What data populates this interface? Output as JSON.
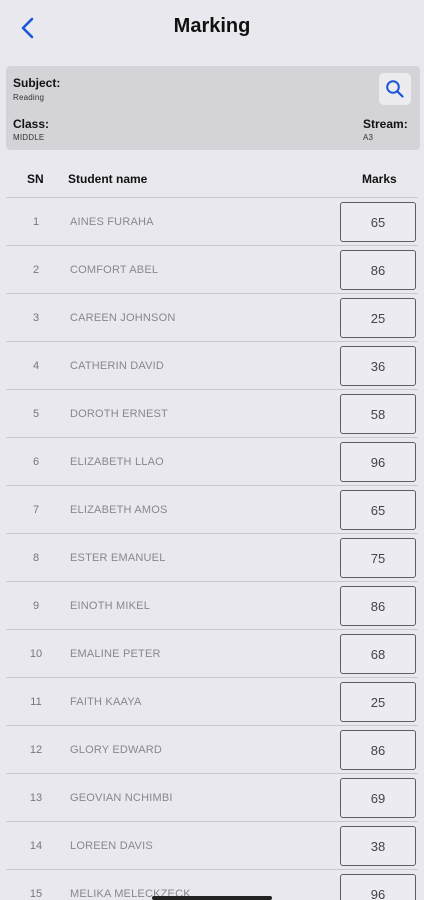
{
  "header": {
    "title": "Marking",
    "back_icon": "chevron-left-icon",
    "accent": "#1a56d6"
  },
  "info": {
    "subject_label": "Subject:",
    "subject_value": "Reading",
    "class_label": "Class:",
    "class_value": "MIDDLE",
    "stream_label": "Stream:",
    "stream_value": "A3",
    "search_icon": "search-icon"
  },
  "table": {
    "columns": {
      "sn": "SN",
      "name": "Student name",
      "marks": "Marks"
    },
    "rows": [
      {
        "sn": "1",
        "name": "AINES FURAHA",
        "mark": "65"
      },
      {
        "sn": "2",
        "name": "COMFORT ABEL",
        "mark": "86"
      },
      {
        "sn": "3",
        "name": "CAREEN JOHNSON",
        "mark": "25"
      },
      {
        "sn": "4",
        "name": "CATHERIN DAVID",
        "mark": "36"
      },
      {
        "sn": "5",
        "name": "DOROTH ERNEST",
        "mark": "58"
      },
      {
        "sn": "6",
        "name": "ELIZABETH LLAO",
        "mark": "96"
      },
      {
        "sn": "7",
        "name": "ELIZABETH AMOS",
        "mark": "65"
      },
      {
        "sn": "8",
        "name": "ESTER EMANUEL",
        "mark": "75"
      },
      {
        "sn": "9",
        "name": "EINOTH MIKEL",
        "mark": "86"
      },
      {
        "sn": "10",
        "name": "EMALINE PETER",
        "mark": "68"
      },
      {
        "sn": "11",
        "name": "FAITH KAAYA",
        "mark": "25"
      },
      {
        "sn": "12",
        "name": "GLORY EDWARD",
        "mark": "86"
      },
      {
        "sn": "13",
        "name": "GEOVIAN NCHIMBI",
        "mark": "69"
      },
      {
        "sn": "14",
        "name": "LOREEN DAVIS",
        "mark": "38"
      },
      {
        "sn": "15",
        "name": "MELIKA MELECKZECK",
        "mark": "96"
      }
    ]
  }
}
